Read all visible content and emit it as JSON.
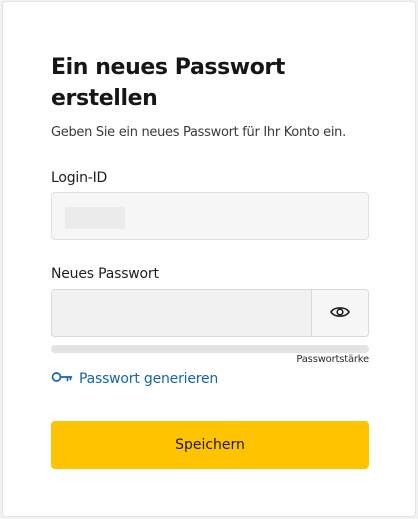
{
  "form": {
    "title": "Ein neues Passwort erstellen",
    "subtitle": "Geben Sie ein neues Passwort für Ihr Konto ein.",
    "login_label": "Login-ID",
    "login_value": "",
    "password_label": "Neues Passwort",
    "password_value": "",
    "strength_label": "Passwortstärke",
    "strength_level": 0,
    "generate_link": "Passwort generieren",
    "save_button": "Speichern"
  },
  "colors": {
    "accent_button": "#ffc300",
    "link": "#1565a8",
    "strength_track": "#e3e3e3"
  },
  "icons": {
    "password_toggle": "eye-icon",
    "generate": "key-icon"
  }
}
